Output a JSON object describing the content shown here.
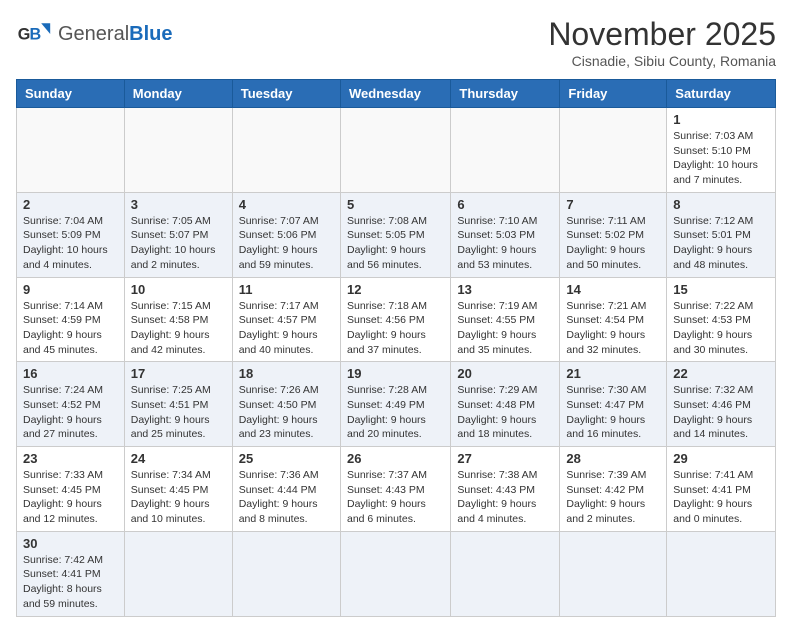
{
  "logo": {
    "text_general": "General",
    "text_blue": "Blue"
  },
  "title": "November 2025",
  "location": "Cisnadie, Sibiu County, Romania",
  "days_of_week": [
    "Sunday",
    "Monday",
    "Tuesday",
    "Wednesday",
    "Thursday",
    "Friday",
    "Saturday"
  ],
  "weeks": [
    [
      null,
      null,
      null,
      null,
      null,
      null,
      {
        "day": "1",
        "info": "Sunrise: 7:03 AM\nSunset: 5:10 PM\nDaylight: 10 hours and 7 minutes."
      }
    ],
    [
      {
        "day": "2",
        "info": "Sunrise: 7:04 AM\nSunset: 5:09 PM\nDaylight: 10 hours and 4 minutes."
      },
      {
        "day": "3",
        "info": "Sunrise: 7:05 AM\nSunset: 5:07 PM\nDaylight: 10 hours and 2 minutes."
      },
      {
        "day": "4",
        "info": "Sunrise: 7:07 AM\nSunset: 5:06 PM\nDaylight: 9 hours and 59 minutes."
      },
      {
        "day": "5",
        "info": "Sunrise: 7:08 AM\nSunset: 5:05 PM\nDaylight: 9 hours and 56 minutes."
      },
      {
        "day": "6",
        "info": "Sunrise: 7:10 AM\nSunset: 5:03 PM\nDaylight: 9 hours and 53 minutes."
      },
      {
        "day": "7",
        "info": "Sunrise: 7:11 AM\nSunset: 5:02 PM\nDaylight: 9 hours and 50 minutes."
      },
      {
        "day": "8",
        "info": "Sunrise: 7:12 AM\nSunset: 5:01 PM\nDaylight: 9 hours and 48 minutes."
      }
    ],
    [
      {
        "day": "9",
        "info": "Sunrise: 7:14 AM\nSunset: 4:59 PM\nDaylight: 9 hours and 45 minutes."
      },
      {
        "day": "10",
        "info": "Sunrise: 7:15 AM\nSunset: 4:58 PM\nDaylight: 9 hours and 42 minutes."
      },
      {
        "day": "11",
        "info": "Sunrise: 7:17 AM\nSunset: 4:57 PM\nDaylight: 9 hours and 40 minutes."
      },
      {
        "day": "12",
        "info": "Sunrise: 7:18 AM\nSunset: 4:56 PM\nDaylight: 9 hours and 37 minutes."
      },
      {
        "day": "13",
        "info": "Sunrise: 7:19 AM\nSunset: 4:55 PM\nDaylight: 9 hours and 35 minutes."
      },
      {
        "day": "14",
        "info": "Sunrise: 7:21 AM\nSunset: 4:54 PM\nDaylight: 9 hours and 32 minutes."
      },
      {
        "day": "15",
        "info": "Sunrise: 7:22 AM\nSunset: 4:53 PM\nDaylight: 9 hours and 30 minutes."
      }
    ],
    [
      {
        "day": "16",
        "info": "Sunrise: 7:24 AM\nSunset: 4:52 PM\nDaylight: 9 hours and 27 minutes."
      },
      {
        "day": "17",
        "info": "Sunrise: 7:25 AM\nSunset: 4:51 PM\nDaylight: 9 hours and 25 minutes."
      },
      {
        "day": "18",
        "info": "Sunrise: 7:26 AM\nSunset: 4:50 PM\nDaylight: 9 hours and 23 minutes."
      },
      {
        "day": "19",
        "info": "Sunrise: 7:28 AM\nSunset: 4:49 PM\nDaylight: 9 hours and 20 minutes."
      },
      {
        "day": "20",
        "info": "Sunrise: 7:29 AM\nSunset: 4:48 PM\nDaylight: 9 hours and 18 minutes."
      },
      {
        "day": "21",
        "info": "Sunrise: 7:30 AM\nSunset: 4:47 PM\nDaylight: 9 hours and 16 minutes."
      },
      {
        "day": "22",
        "info": "Sunrise: 7:32 AM\nSunset: 4:46 PM\nDaylight: 9 hours and 14 minutes."
      }
    ],
    [
      {
        "day": "23",
        "info": "Sunrise: 7:33 AM\nSunset: 4:45 PM\nDaylight: 9 hours and 12 minutes."
      },
      {
        "day": "24",
        "info": "Sunrise: 7:34 AM\nSunset: 4:45 PM\nDaylight: 9 hours and 10 minutes."
      },
      {
        "day": "25",
        "info": "Sunrise: 7:36 AM\nSunset: 4:44 PM\nDaylight: 9 hours and 8 minutes."
      },
      {
        "day": "26",
        "info": "Sunrise: 7:37 AM\nSunset: 4:43 PM\nDaylight: 9 hours and 6 minutes."
      },
      {
        "day": "27",
        "info": "Sunrise: 7:38 AM\nSunset: 4:43 PM\nDaylight: 9 hours and 4 minutes."
      },
      {
        "day": "28",
        "info": "Sunrise: 7:39 AM\nSunset: 4:42 PM\nDaylight: 9 hours and 2 minutes."
      },
      {
        "day": "29",
        "info": "Sunrise: 7:41 AM\nSunset: 4:41 PM\nDaylight: 9 hours and 0 minutes."
      }
    ],
    [
      {
        "day": "30",
        "info": "Sunrise: 7:42 AM\nSunset: 4:41 PM\nDaylight: 8 hours and 59 minutes."
      },
      null,
      null,
      null,
      null,
      null,
      null
    ]
  ],
  "row_shade": [
    false,
    true,
    false,
    true,
    false,
    true
  ]
}
